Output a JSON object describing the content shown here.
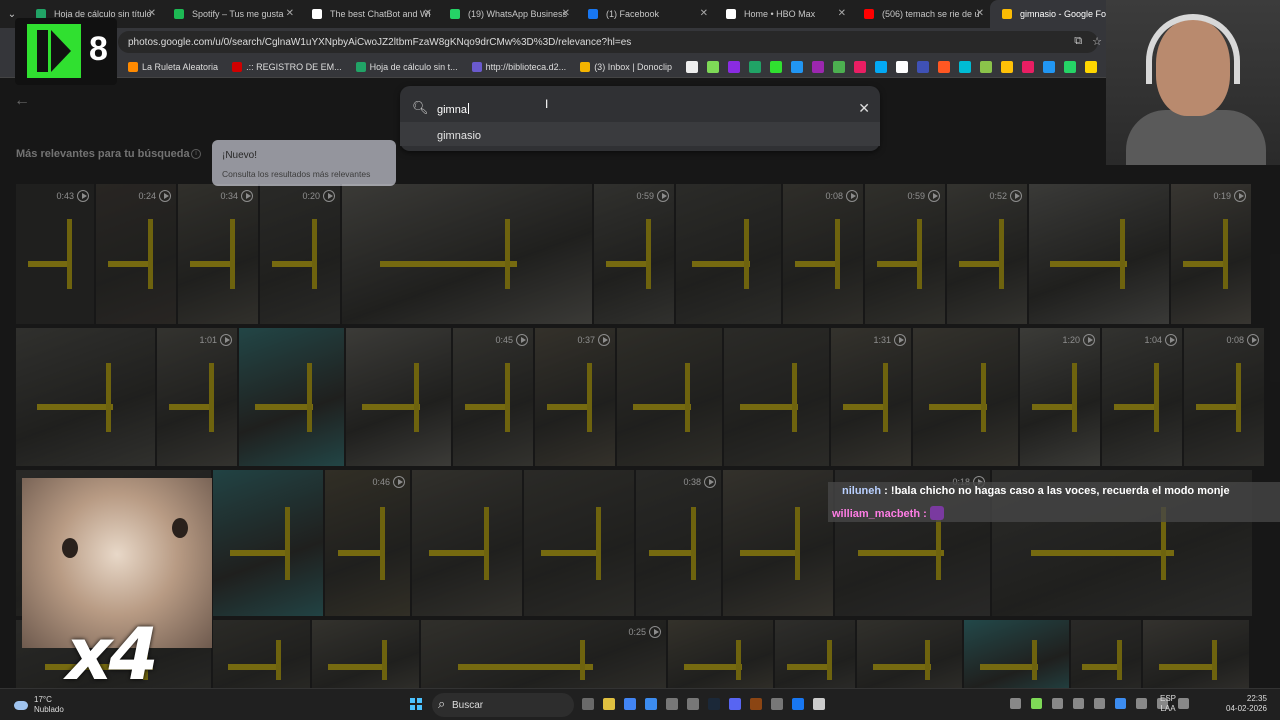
{
  "tabs": [
    {
      "title": "Hoja de cálculo sin título",
      "color": "#21a366"
    },
    {
      "title": "Spotify – Tus me gusta",
      "color": "#1db954"
    },
    {
      "title": "The best ChatBot and Wi",
      "color": "#ffffff"
    },
    {
      "title": "(19) WhatsApp Business",
      "color": "#25d366"
    },
    {
      "title": "(1) Facebook",
      "color": "#1877f2"
    },
    {
      "title": "Home • HBO Max",
      "color": "#ffffff"
    },
    {
      "title": "(506) temach se rie de u",
      "color": "#ff0000"
    },
    {
      "title": "gimnasio - Google Fotos",
      "color": "#fbbc04"
    }
  ],
  "address": {
    "url": "photos.google.com/u/0/search/CglnaW1uYXNpbyAiCwoJZ2ltbmFzaW8gKNqo9drCMw%3D%3D/relevance?hl=es"
  },
  "bookmarks": [
    {
      "label": "La Ruleta Aleatoria",
      "color": "#ff8a00"
    },
    {
      "label": ".:: REGISTRO DE EM...",
      "color": "#d00000"
    },
    {
      "label": "Hoja de cálculo sin t...",
      "color": "#21a366"
    },
    {
      "label": "http://biblioteca.d2...",
      "color": "#6a5acd"
    },
    {
      "label": "(3) Inbox | Donoclip",
      "color": "#f4b400"
    }
  ],
  "bookmark_icon_colors": [
    "#eeeeee",
    "#7ed957",
    "#8a2be2",
    "#21a366",
    "#30e030",
    "#2196f3",
    "#9c27b0",
    "#4caf50",
    "#e91e63",
    "#03a9f4",
    "#ffffff",
    "#3f51b5",
    "#ff5722",
    "#00bcd4",
    "#8bc34a",
    "#ffc107",
    "#e91e63",
    "#2196f3",
    "#25d366",
    "#ffd600",
    "#ff5722",
    "#4caf50",
    "#0088cc",
    "#8bc34a",
    "#ff9800"
  ],
  "search": {
    "query": "gimna",
    "suggestion": "gimnasio"
  },
  "section": {
    "heading": "Más relevantes para tu búsqueda"
  },
  "tooltip": {
    "title": "¡Nuevo!",
    "body": "Consulta los resultados más relevantes"
  },
  "photo_rows": [
    [
      {
        "w": 78,
        "dur": "0:43",
        "tone": "#3a3a38"
      },
      {
        "w": 80,
        "dur": "0:24",
        "tone": "#4a4540"
      },
      {
        "w": 80,
        "dur": "0:34",
        "tone": "#5a5850"
      },
      {
        "w": 80,
        "dur": "0:20",
        "tone": "#4c4c48"
      },
      {
        "w": 250,
        "dur": "",
        "tone": "#6b6a64"
      },
      {
        "w": 80,
        "dur": "0:59",
        "tone": "#595954"
      },
      {
        "w": 105,
        "dur": "",
        "tone": "#4f4f4a"
      },
      {
        "w": 80,
        "dur": "0:08",
        "tone": "#56544c"
      },
      {
        "w": 80,
        "dur": "0:59",
        "tone": "#58574f"
      },
      {
        "w": 80,
        "dur": "0:52",
        "tone": "#5e5d56"
      },
      {
        "w": 140,
        "dur": "",
        "tone": "#6a6a66"
      },
      {
        "w": 80,
        "dur": "0:19",
        "tone": "#66625a"
      }
    ],
    [
      {
        "w": 139,
        "dur": "",
        "tone": "#585853"
      },
      {
        "w": 80,
        "dur": "1:01",
        "tone": "#5e5d56"
      },
      {
        "w": 105,
        "dur": "",
        "tone": "#3e7f80"
      },
      {
        "w": 105,
        "dur": "",
        "tone": "#6d6c66"
      },
      {
        "w": 80,
        "dur": "0:45",
        "tone": "#5c5b54"
      },
      {
        "w": 80,
        "dur": "0:37",
        "tone": "#5f5a4e"
      },
      {
        "w": 105,
        "dur": "",
        "tone": "#555349"
      },
      {
        "w": 105,
        "dur": "",
        "tone": "#4f4e48"
      },
      {
        "w": 80,
        "dur": "1:31",
        "tone": "#5f5c52"
      },
      {
        "w": 105,
        "dur": "",
        "tone": "#5e5b51"
      },
      {
        "w": 80,
        "dur": "1:20",
        "tone": "#6c6c66"
      },
      {
        "w": 80,
        "dur": "1:04",
        "tone": "#5c5c57"
      },
      {
        "w": 80,
        "dur": "0:08",
        "tone": "#55544f"
      }
    ],
    [
      {
        "w": 195,
        "dur": "",
        "tone": "#4a4a46"
      },
      {
        "w": 110,
        "dur": "",
        "tone": "#3d7a7c"
      },
      {
        "w": 85,
        "dur": "0:46",
        "tone": "#5a5545"
      },
      {
        "w": 110,
        "dur": "",
        "tone": "#5a5850"
      },
      {
        "w": 110,
        "dur": "",
        "tone": "#4e4d47"
      },
      {
        "w": 85,
        "dur": "0:38",
        "tone": "#4a4a46"
      },
      {
        "w": 110,
        "dur": "",
        "tone": "#5e5a50"
      },
      {
        "w": 155,
        "dur": "0:18",
        "tone": "#4b4a48"
      },
      {
        "w": 260,
        "dur": "",
        "tone": "#4e4e4b"
      }
    ],
    [
      {
        "w": 195,
        "dur": "",
        "tone": "#4b4b47"
      },
      {
        "w": 97,
        "dur": "",
        "tone": "#4f4e47"
      },
      {
        "w": 107,
        "dur": "",
        "tone": "#5e5c53"
      },
      {
        "w": 245,
        "dur": "0:25",
        "tone": "#59574f"
      },
      {
        "w": 105,
        "dur": "",
        "tone": "#5f5b4e"
      },
      {
        "w": 80,
        "dur": "",
        "tone": "#55544f"
      },
      {
        "w": 105,
        "dur": "",
        "tone": "#5a5850"
      },
      {
        "w": 105,
        "dur": "",
        "tone": "#3f8486"
      },
      {
        "w": 70,
        "dur": "",
        "tone": "#4d4c48"
      },
      {
        "w": 106,
        "dur": "",
        "tone": "#5f5c55"
      }
    ]
  ],
  "overlay": {
    "brand_number": "8",
    "speed": "x4"
  },
  "chat": {
    "user1": "niluneh",
    "msg1": "!bala chicho no hagas caso a las voces, recuerda el modo monje",
    "user2": "william_macbeth",
    "sep": ":"
  },
  "taskbar": {
    "temp": "17°C",
    "weather": "Nublado",
    "search_label": "Buscar",
    "lang1": "ESP",
    "lang2": "LAA",
    "time": "22:35",
    "date": "04-02-2026"
  }
}
